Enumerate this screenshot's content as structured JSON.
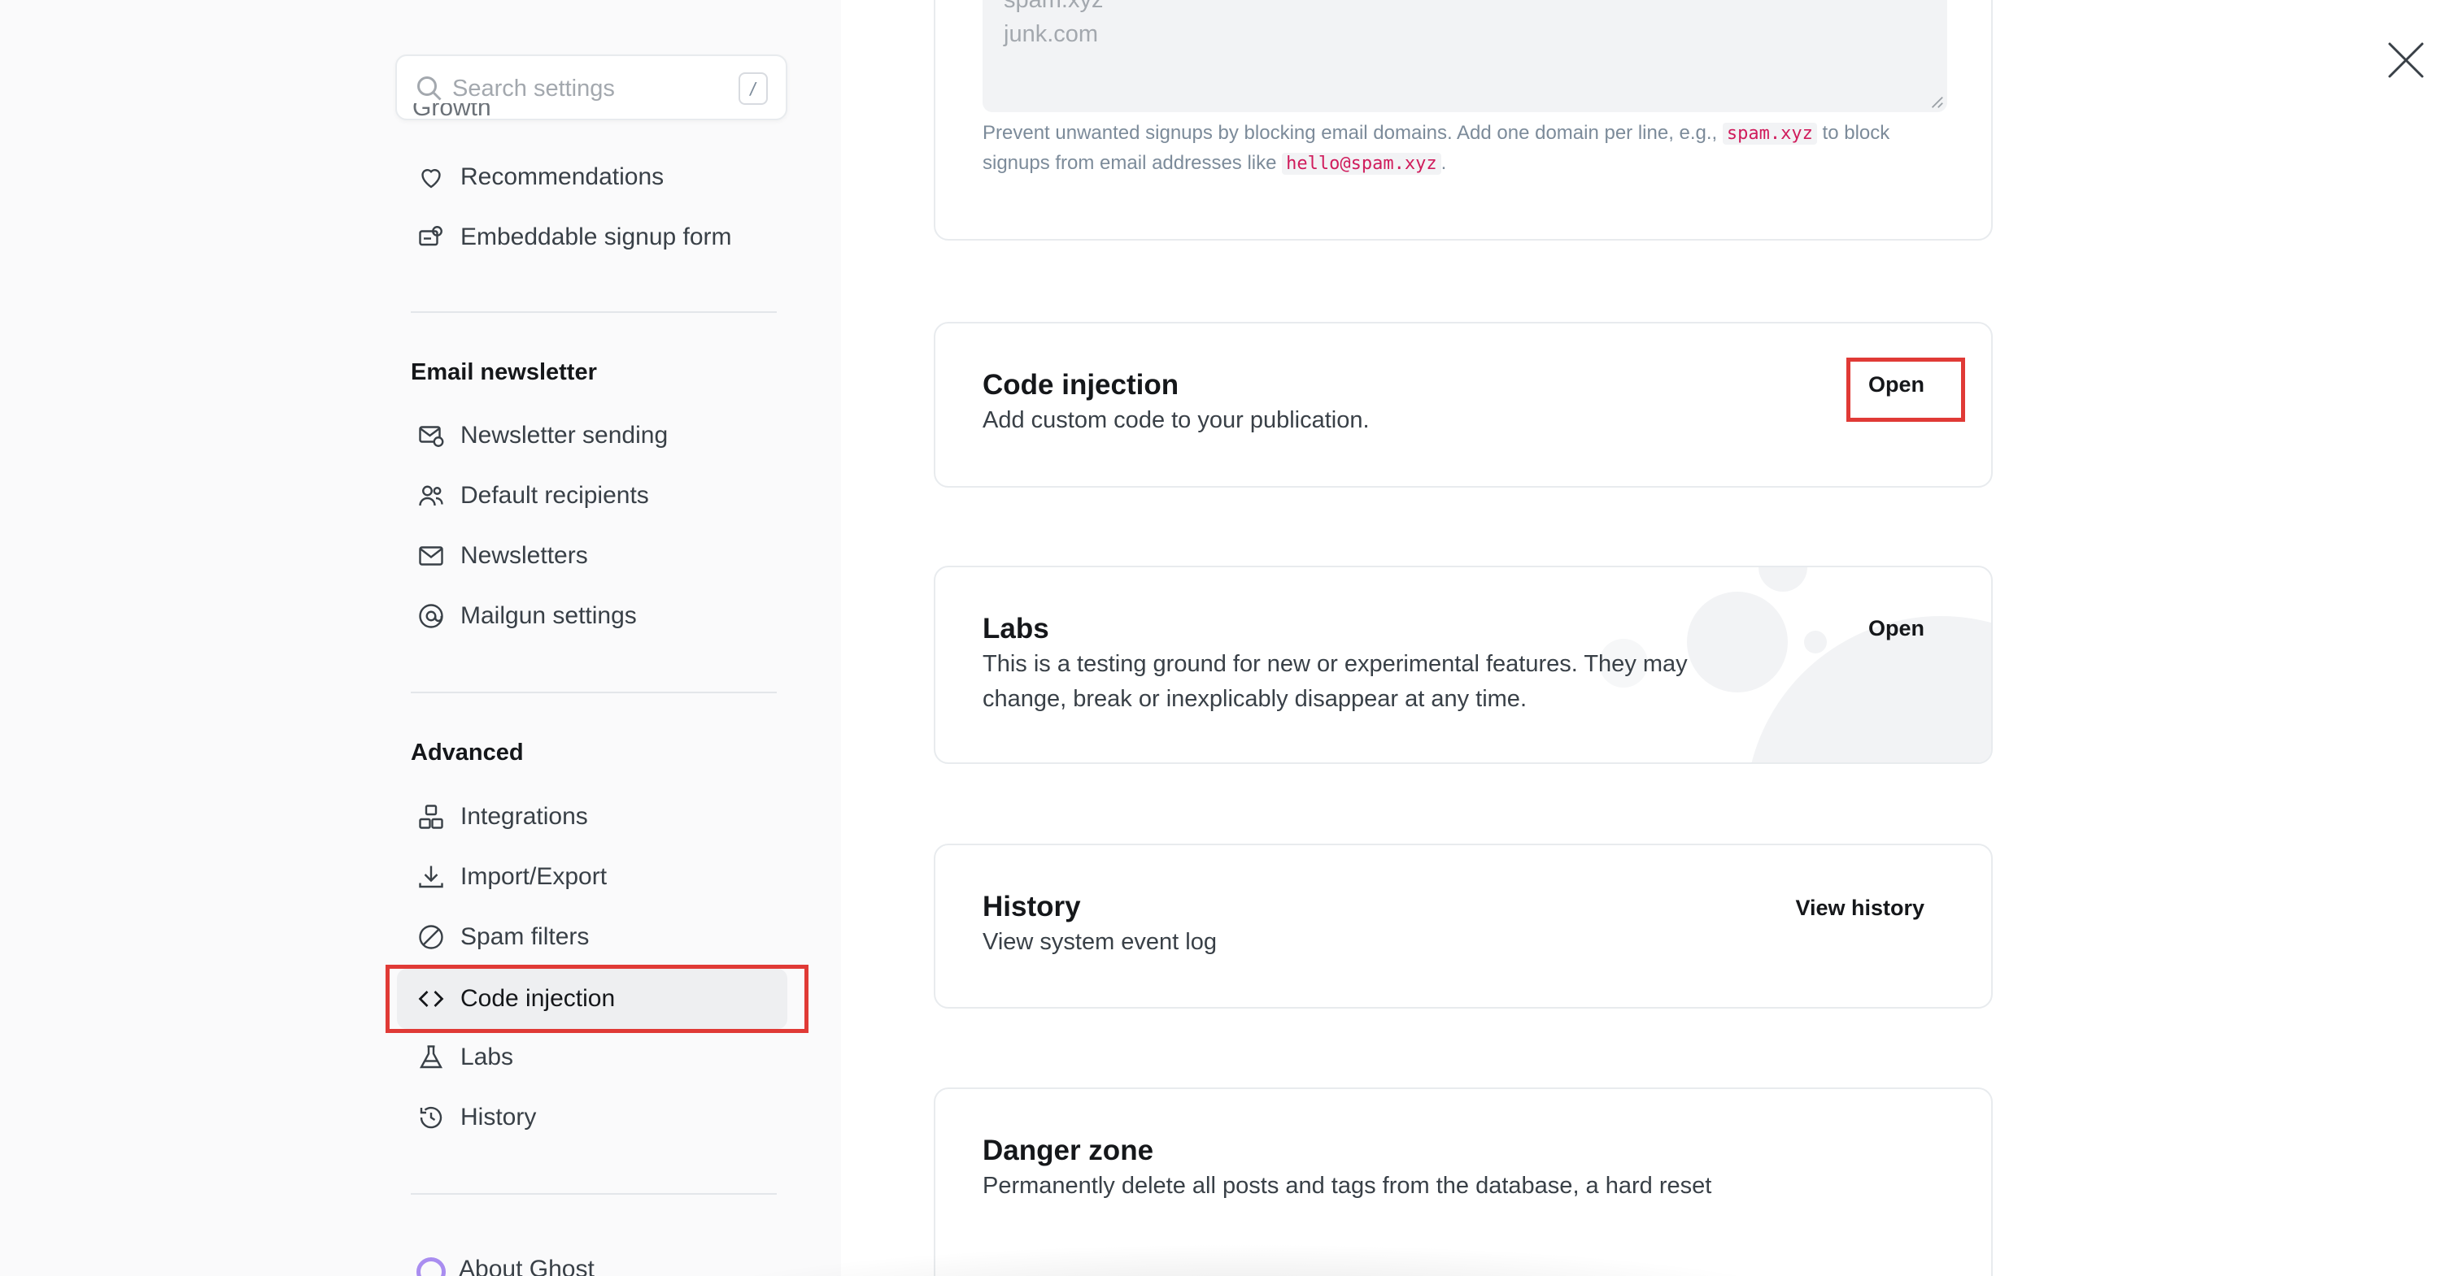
{
  "search": {
    "placeholder": "Search settings",
    "shortcut": "/"
  },
  "sidebar": {
    "cut_label": "Growth",
    "growth_items": [
      {
        "label": "Recommendations",
        "icon": "heart-icon"
      },
      {
        "label": "Embeddable signup form",
        "icon": "signup-form-icon"
      }
    ],
    "email_title": "Email newsletter",
    "email_items": [
      {
        "label": "Newsletter sending",
        "icon": "mail-settings-icon"
      },
      {
        "label": "Default recipients",
        "icon": "recipients-icon"
      },
      {
        "label": "Newsletters",
        "icon": "envelope-icon"
      },
      {
        "label": "Mailgun settings",
        "icon": "at-sign-icon"
      }
    ],
    "advanced_title": "Advanced",
    "advanced_items": [
      {
        "label": "Integrations",
        "icon": "integrations-icon"
      },
      {
        "label": "Import/Export",
        "icon": "download-icon"
      },
      {
        "label": "Spam filters",
        "icon": "block-icon"
      },
      {
        "label": "Code injection",
        "icon": "code-icon",
        "active": true
      },
      {
        "label": "Labs",
        "icon": "flask-icon"
      },
      {
        "label": "History",
        "icon": "history-icon"
      }
    ],
    "about_label": "About Ghost"
  },
  "spam": {
    "lines": [
      "spam.xyz",
      "junk.com"
    ],
    "hint_before": "Prevent unwanted signups by blocking email domains. Add one domain per line, e.g.,",
    "hint_code_1": "spam.xyz",
    "hint_middle": "to block signups from email addresses like",
    "hint_code_2": "hello@spam.xyz",
    "hint_end": "."
  },
  "code_injection": {
    "title": "Code injection",
    "desc": "Add custom code to your publication.",
    "action": "Open"
  },
  "labs": {
    "title": "Labs",
    "desc": "This is a testing ground for new or experimental features. They may change, break or inexplicably disappear at any time.",
    "action": "Open"
  },
  "history": {
    "title": "History",
    "desc": "View system event log",
    "action": "View history"
  },
  "danger": {
    "title": "Danger zone",
    "desc": "Permanently delete all posts and tags from the database, a hard reset"
  },
  "colors": {
    "highlight": "#e03a36",
    "danger": "#e03a36",
    "code": "#d01c5c"
  }
}
